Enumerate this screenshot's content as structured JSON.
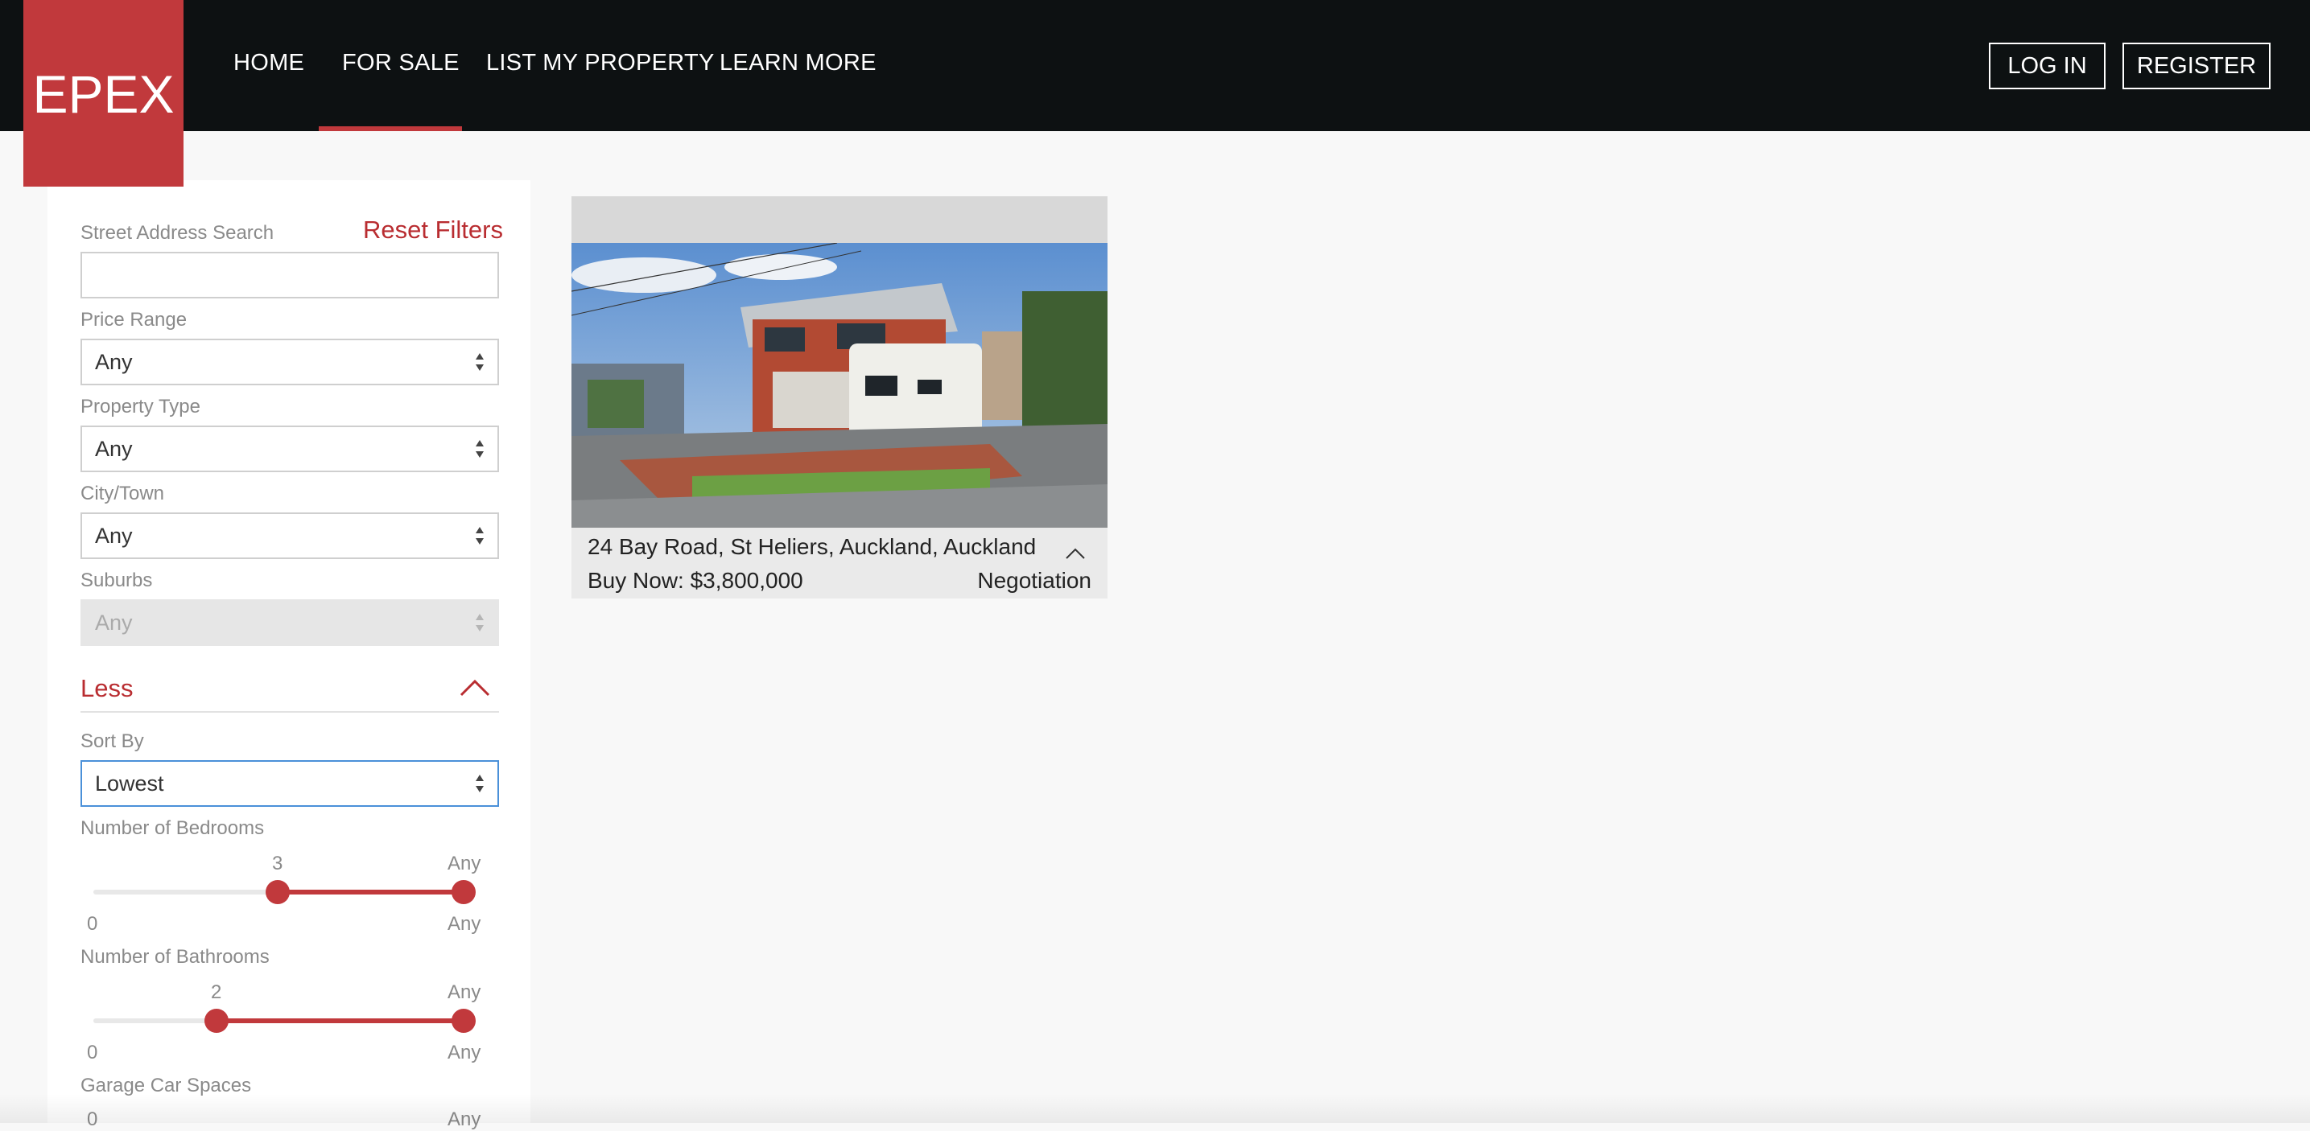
{
  "header": {
    "logo_text": "EPEX",
    "nav": [
      {
        "label": "HOME"
      },
      {
        "label": "FOR SALE",
        "active": true
      },
      {
        "label": "LIST MY PROPERTY"
      },
      {
        "label": "LEARN MORE"
      }
    ],
    "login_label": "LOG IN",
    "register_label": "REGISTER"
  },
  "filters": {
    "street_label": "Street Address Search",
    "street_value": "",
    "reset_label": "Reset Filters",
    "price_label": "Price Range",
    "price_value": "Any",
    "type_label": "Property Type",
    "type_value": "Any",
    "city_label": "City/Town",
    "city_value": "Any",
    "suburbs_label": "Suburbs",
    "suburbs_value": "Any",
    "less_label": "Less",
    "sort_label": "Sort By",
    "sort_value": "Lowest",
    "bedrooms": {
      "label": "Number of Bedrooms",
      "min_label": "0",
      "max_label": "Any",
      "low_value": "3",
      "high_value": "Any"
    },
    "bathrooms": {
      "label": "Number of Bathrooms",
      "min_label": "0",
      "max_label": "Any",
      "low_value": "2",
      "high_value": "Any"
    },
    "garage": {
      "label": "Garage Car Spaces",
      "min_label": "0",
      "max_label": "Any"
    }
  },
  "listing": {
    "address": "24 Bay Road, St Heliers, Auckland, Auckland",
    "price": "Buy Now: $3,800,000",
    "method": "Negotiation"
  },
  "colors": {
    "accent": "#c1393c",
    "header_bg": "#0d1112",
    "page_bg": "#f8f8f8"
  }
}
